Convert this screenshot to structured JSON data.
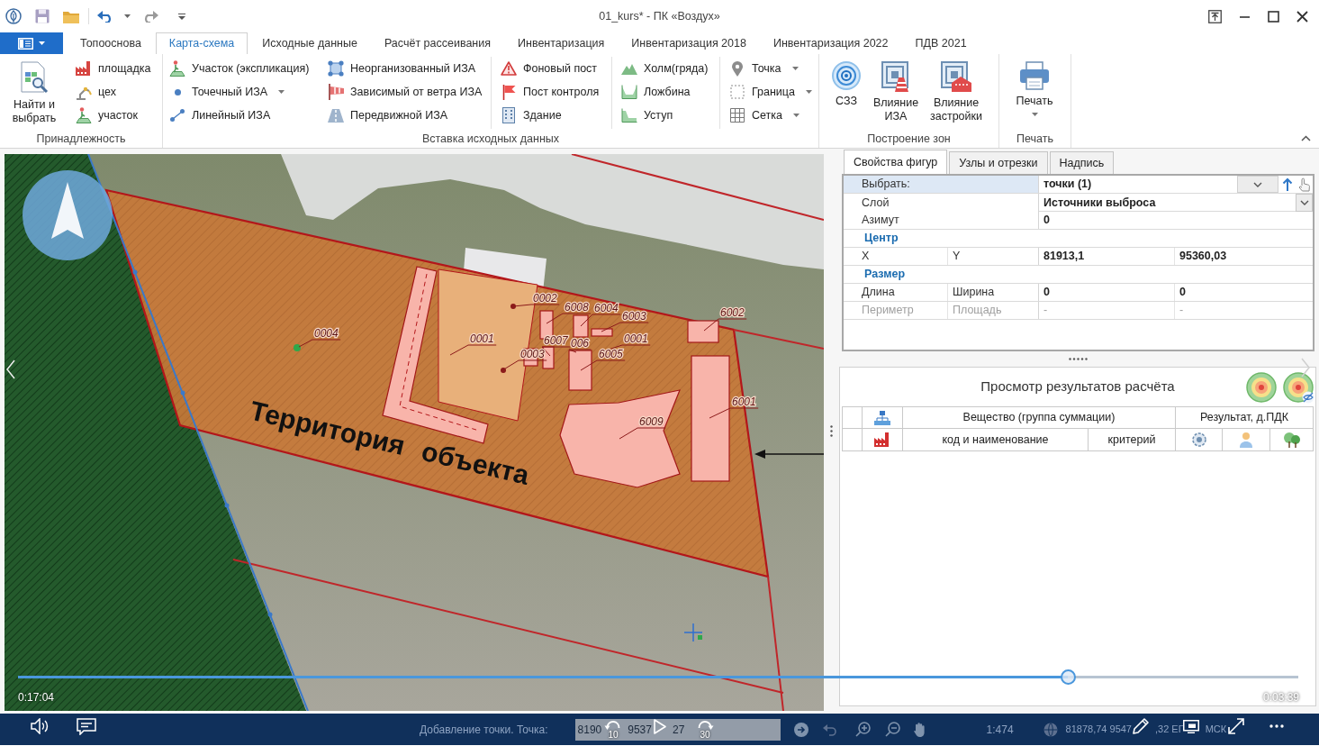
{
  "title_bar": {
    "title": "01_kurs* - ПК «Воздух»"
  },
  "ribbon_tabs": [
    {
      "label": "Топооснова",
      "selected": false
    },
    {
      "label": "Карта-схема",
      "selected": true
    },
    {
      "label": "Исходные данные",
      "selected": false
    },
    {
      "label": "Расчёт рассеивания",
      "selected": false
    },
    {
      "label": "Инвентаризация",
      "selected": false
    },
    {
      "label": "Инвентаризация 2018",
      "selected": false
    },
    {
      "label": "Инвентаризация 2022",
      "selected": false
    },
    {
      "label": "ПДВ 2021",
      "selected": false
    }
  ],
  "ribbon_groups": [
    {
      "label": "Принадлежность",
      "large_buttons": [
        {
          "label": "Найти и выбрать",
          "dropdown": false
        }
      ],
      "sets": [
        [
          [
            {
              "label": "площадка",
              "dropdown": false
            },
            {
              "label": "цех",
              "dropdown": false
            },
            {
              "label": "участок",
              "dropdown": false
            }
          ]
        ]
      ]
    },
    {
      "label": "Вставка исходных данных",
      "sets": [
        [
          [
            {
              "label": "Участок (экспликация)",
              "dropdown": false
            },
            {
              "label": "Точечный ИЗА",
              "dropdown": true
            },
            {
              "label": "Линейный ИЗА",
              "dropdown": false
            }
          ],
          [
            {
              "label": "Неорганизованный ИЗА",
              "dropdown": false
            },
            {
              "label": "Зависимый от ветра ИЗА",
              "dropdown": false
            },
            {
              "label": "Передвижной ИЗА",
              "dropdown": false
            }
          ]
        ],
        [
          [
            {
              "label": "Фоновый пост",
              "dropdown": false
            },
            {
              "label": "Пост контроля",
              "dropdown": false
            },
            {
              "label": "Здание",
              "dropdown": false
            }
          ]
        ],
        [
          [
            {
              "label": "Холм(гряда)",
              "dropdown": false
            },
            {
              "label": "Ложбина",
              "dropdown": false
            },
            {
              "label": "Уступ",
              "dropdown": false
            }
          ]
        ],
        [
          [
            {
              "label": "Точка",
              "dropdown": true
            },
            {
              "label": "Граница",
              "dropdown": true
            },
            {
              "label": "Сетка",
              "dropdown": true
            }
          ]
        ]
      ]
    },
    {
      "label": "Построение зон",
      "large_buttons": [
        {
          "label": "СЗЗ",
          "dropdown": false
        },
        {
          "label": "Влияние ИЗА",
          "dropdown": false
        },
        {
          "label": "Влияние застройки",
          "dropdown": false
        }
      ]
    },
    {
      "label": "Печать",
      "large_buttons": [
        {
          "label": "Печать",
          "dropdown": true
        }
      ]
    }
  ],
  "map": {
    "caption": "Территория объекта",
    "source_labels": [
      {
        "text": "0004"
      },
      {
        "text": "0002"
      },
      {
        "text": "0001"
      },
      {
        "text": "6008"
      },
      {
        "text": "6004"
      },
      {
        "text": "6003"
      },
      {
        "text": "6002"
      },
      {
        "text": "6007"
      },
      {
        "text": "006"
      },
      {
        "text": "0001"
      },
      {
        "text": "0003"
      },
      {
        "text": "6005"
      },
      {
        "text": "6009"
      },
      {
        "text": "6001"
      }
    ]
  },
  "properties_panel": {
    "tabs": [
      {
        "label": "Свойства фигур",
        "selected": true
      },
      {
        "label": "Узлы и отрезки",
        "selected": false
      },
      {
        "label": "Надпись",
        "selected": false
      }
    ],
    "rows": [
      {
        "kind": "select",
        "label": "Выбрать:",
        "value": "точки (1)",
        "selected": true
      },
      {
        "kind": "dropdown",
        "label": "Слой",
        "value": "Источники выброса",
        "selected": false
      },
      {
        "kind": "field",
        "label": "Азимут",
        "value": "0",
        "selected": false
      },
      {
        "kind": "category",
        "label": "Центр",
        "selected": false
      },
      {
        "kind": "pair",
        "labels": [
          "X",
          "Y"
        ],
        "values": [
          "81913,1",
          "95360,03"
        ],
        "disabled": false,
        "selected": false
      },
      {
        "kind": "category",
        "label": "Размер",
        "selected": false
      },
      {
        "kind": "pair",
        "labels": [
          "Длина",
          "Ширина"
        ],
        "values": [
          "0",
          "0"
        ],
        "disabled": false,
        "selected": false
      },
      {
        "kind": "pair",
        "labels": [
          "Периметр",
          "Площадь"
        ],
        "values": [
          "-",
          "-"
        ],
        "disabled": true,
        "selected": false
      }
    ]
  },
  "results_panel": {
    "title": "Просмотр результатов расчёта",
    "header_top": [
      "Вещество (группа суммации)",
      "Результат, д.ПДК"
    ],
    "header_bottom": [
      "код и наименование",
      "критерий"
    ]
  },
  "video_player": {
    "elapsed": "0:17:04",
    "remaining": "0:03:39",
    "progress": {
      "level": 0.82
    },
    "skip_back": "10",
    "skip_forward": "30"
  },
  "status_bar": {
    "message": "Добавление точки. Точка:",
    "point_value_parts": [
      "8190",
      "9537",
      "27"
    ],
    "scale": "1:474",
    "cursor_coordinate_parts": [
      "81878,74 9547",
      ",32 ЕГ",
      "МСК"
    ]
  }
}
